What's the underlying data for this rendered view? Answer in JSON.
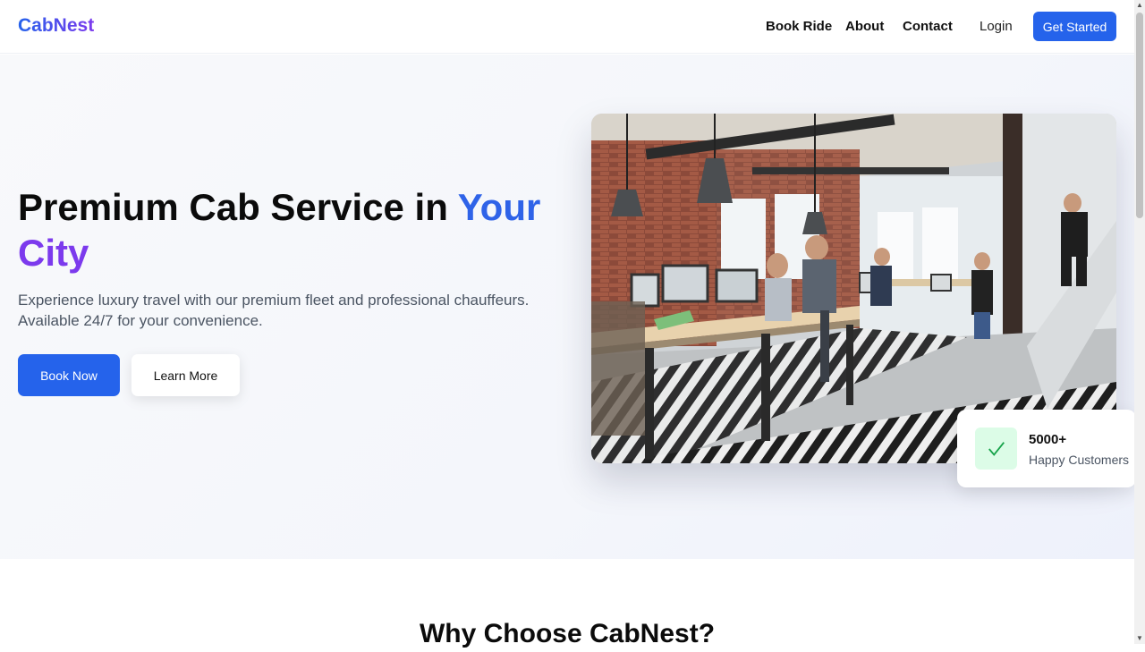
{
  "nav": {
    "logo": "CabNest",
    "links": [
      "Book Ride",
      "About",
      "Contact"
    ],
    "login": "Login",
    "cta": "Get Started"
  },
  "hero": {
    "title_main": "Premium Cab Service in ",
    "title_highlight_1": "Your",
    "title_highlight_2": "City",
    "subtitle": "Experience luxury travel with our premium fleet and professional chauffeurs. Available 24/7 for your convenience.",
    "primary_button": "Book Now",
    "secondary_button": "Learn More"
  },
  "stats": {
    "number": "5000+",
    "label": "Happy Customers",
    "icon": "check-icon"
  },
  "section": {
    "title": "Why Choose CabNest?"
  },
  "colors": {
    "primary": "#2563eb",
    "accent": "#7c3aed",
    "success_bg": "#dcfce7",
    "success": "#16a34a"
  }
}
